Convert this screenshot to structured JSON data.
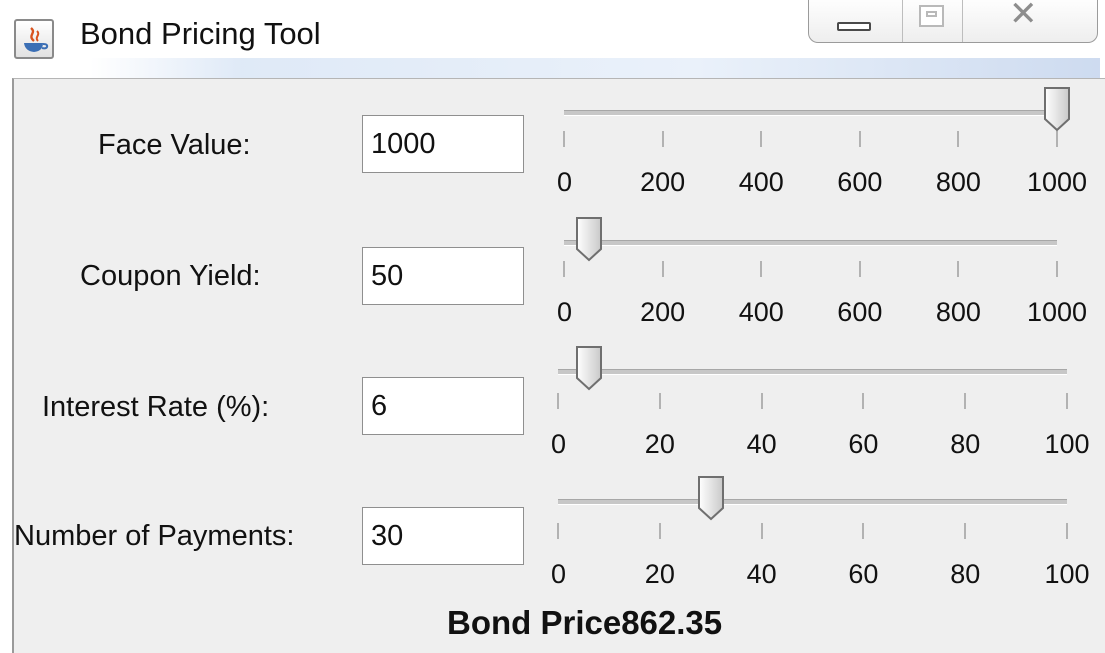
{
  "window": {
    "title": "Bond Pricing Tool",
    "controls": {
      "minimize": "minimize",
      "maximize": "maximize",
      "close": "close"
    }
  },
  "fields": [
    {
      "label": "Face Value:",
      "value": "1000",
      "slider": {
        "min": 0,
        "max": 1000,
        "value": 1000,
        "ticks": [
          "0",
          "200",
          "400",
          "600",
          "800",
          "1000"
        ]
      }
    },
    {
      "label": "Coupon Yield:",
      "value": "50",
      "slider": {
        "min": 0,
        "max": 1000,
        "value": 50,
        "ticks": [
          "0",
          "200",
          "400",
          "600",
          "800",
          "1000"
        ]
      }
    },
    {
      "label": "Interest Rate (%):",
      "value": "6",
      "slider": {
        "min": 0,
        "max": 100,
        "value": 6,
        "ticks": [
          "0",
          "20",
          "40",
          "60",
          "80",
          "100"
        ]
      }
    },
    {
      "label": "Number of Payments:",
      "value": "30",
      "slider": {
        "min": 0,
        "max": 100,
        "value": 30,
        "ticks": [
          "0",
          "20",
          "40",
          "60",
          "80",
          "100"
        ]
      }
    }
  ],
  "result": {
    "text": "Bond Price862.35"
  }
}
